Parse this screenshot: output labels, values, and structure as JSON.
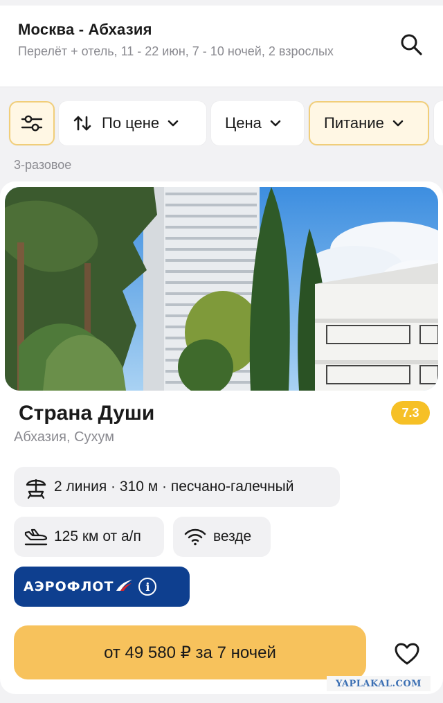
{
  "header": {
    "title": "Москва - Абхазия",
    "subtitle": "Перелёт + отель, 11 - 22 июн, 7 - 10 ночей, 2 взрослых",
    "search_icon": "search-icon"
  },
  "filters": {
    "settings_icon": "sliders-icon",
    "sort_label": "По цене",
    "price_label": "Цена",
    "food_label": "Питание",
    "meal_caption": "3-разовое"
  },
  "hotel": {
    "name": "Страна Души",
    "rating": "7.3",
    "location": "Абхазия, Сухум",
    "beach": "2 линия · 310 м · песчано-галечный",
    "airport": "125 км от а/п",
    "wifi": "везде",
    "airline": "АЭРОФЛОТ",
    "price_button": "от 49 580 ₽ за 7 ночей"
  },
  "watermark": "YAPLAKAL.COM",
  "colors": {
    "accent": "#f7c25c",
    "active_chip_border": "#f1ce79",
    "rating_badge": "#f6c026",
    "airline_blue": "#0e3f8f"
  }
}
